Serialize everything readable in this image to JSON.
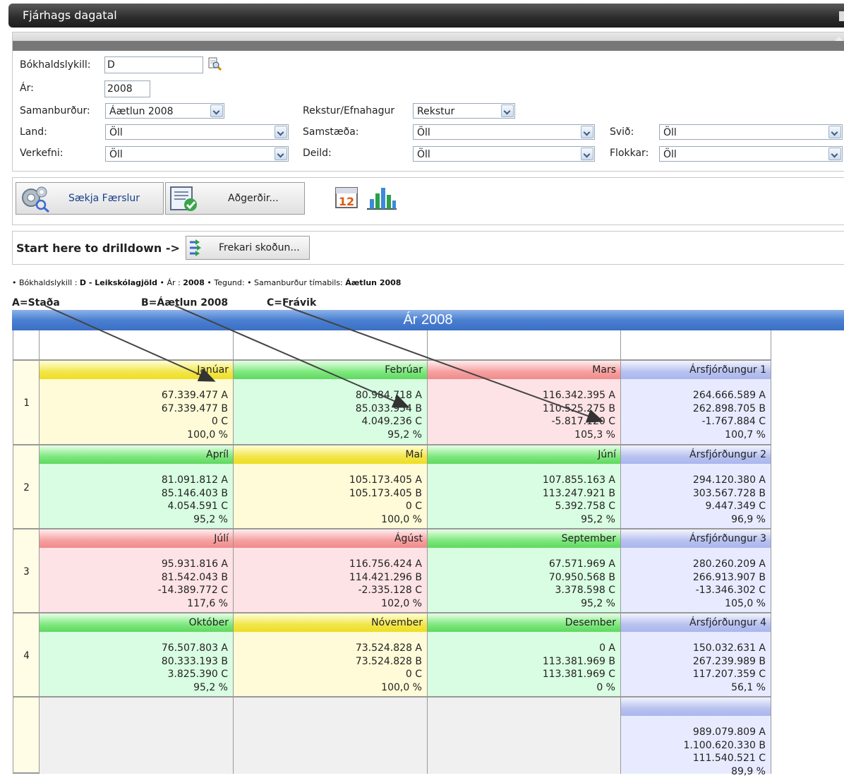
{
  "window": {
    "title": "Fjárhags dagatal"
  },
  "filters": {
    "key_label": "Bókhaldslykill:",
    "key_value": "D",
    "year_label": "Ár:",
    "year_value": "2008",
    "compare_label": "Samanburður:",
    "compare_value": "Áætlun 2008",
    "opexp_label": "Rekstur/Efnahagur",
    "opexp_value": "Rekstur",
    "land_label": "Land:",
    "land_value": "Öll",
    "group_label": "Samstæða:",
    "group_value": "Öll",
    "svid_label": "Svið:",
    "svid_value": "Öll",
    "project_label": "Verkefni:",
    "project_value": "Öll",
    "dept_label": "Deild:",
    "dept_value": "Öll",
    "flokkar_label": "Flokkar:",
    "flokkar_value": "Öll"
  },
  "toolbar": {
    "fetch_label": "Sækja Færslur",
    "actions_label": "Aðgerðir...",
    "calendar_icon_text": "12"
  },
  "drill": {
    "prompt": "Start here to drilldown ->",
    "button_label": "Frekari skoðun..."
  },
  "info": {
    "p1": "• Bókhaldslykill : ",
    "key": "D - Leikskólagjöld",
    "p2": " • Ár : ",
    "year": "2008",
    "p3": " • Tegund: • Samanburður tímabils: ",
    "compare": "Áætlun 2008"
  },
  "legend": {
    "a": "A=Staða",
    "b": "B=Áætlun 2008",
    "c": "C=Frávik"
  },
  "calendar": {
    "year_title": "Ár 2008",
    "rows": [
      {
        "num": "1",
        "cells": [
          {
            "name": "Janúar",
            "a": "67.339.477 A",
            "b": "67.339.477 B",
            "c": "0 C",
            "p": "100,0 %"
          },
          {
            "name": "Febrúar",
            "a": "80.984.718 A",
            "b": "85.033.954 B",
            "c": "4.049.236 C",
            "p": "95,2 %"
          },
          {
            "name": "Mars",
            "a": "116.342.395 A",
            "b": "110.525.275 B",
            "c": "-5.817.120 C",
            "p": "105,3 %"
          },
          {
            "name": "Ársfjórðungur 1",
            "a": "264.666.589 A",
            "b": "262.898.705 B",
            "c": "-1.767.884 C",
            "p": "100,7 %"
          }
        ]
      },
      {
        "num": "2",
        "cells": [
          {
            "name": "Apríl",
            "a": "81.091.812 A",
            "b": "85.146.403 B",
            "c": "4.054.591 C",
            "p": "95,2 %"
          },
          {
            "name": "Maí",
            "a": "105.173.405 A",
            "b": "105.173.405 B",
            "c": "0 C",
            "p": "100,0 %"
          },
          {
            "name": "Júní",
            "a": "107.855.163 A",
            "b": "113.247.921 B",
            "c": "5.392.758 C",
            "p": "95,2 %"
          },
          {
            "name": "Ársfjórðungur 2",
            "a": "294.120.380 A",
            "b": "303.567.728 B",
            "c": "9.447.349 C",
            "p": "96,9 %"
          }
        ]
      },
      {
        "num": "3",
        "cells": [
          {
            "name": "Júlí",
            "a": "95.931.816 A",
            "b": "81.542.043 B",
            "c": "-14.389.772 C",
            "p": "117,6 %"
          },
          {
            "name": "Ágúst",
            "a": "116.756.424 A",
            "b": "114.421.296 B",
            "c": "-2.335.128 C",
            "p": "102,0 %"
          },
          {
            "name": "September",
            "a": "67.571.969 A",
            "b": "70.950.568 B",
            "c": "3.378.598 C",
            "p": "95,2 %"
          },
          {
            "name": "Ársfjórðungur 3",
            "a": "280.260.209 A",
            "b": "266.913.907 B",
            "c": "-13.346.302 C",
            "p": "105,0 %"
          }
        ]
      },
      {
        "num": "4",
        "cells": [
          {
            "name": "Október",
            "a": "76.507.803 A",
            "b": "80.333.193 B",
            "c": "3.825.390 C",
            "p": "95,2 %"
          },
          {
            "name": "Nóvember",
            "a": "73.524.828 A",
            "b": "73.524.828 B",
            "c": "0 C",
            "p": "100,0 %"
          },
          {
            "name": "Desember",
            "a": "0 A",
            "b": "113.381.969 B",
            "c": "113.381.969 C",
            "p": "0 %"
          },
          {
            "name": "Ársfjórðungur 4",
            "a": "150.032.631 A",
            "b": "267.239.989 B",
            "c": "117.207.359 C",
            "p": "56,1 %"
          }
        ]
      }
    ],
    "total": {
      "a": "989.079.809 A",
      "b": "1.100.620.330 B",
      "c": "111.540.521 C",
      "p": "89,9 %"
    }
  },
  "colors": {
    "yellow": "#fffbd8",
    "green": "#d9fde2",
    "red": "#fde3e5",
    "quarter": "#e8ebff",
    "header_blue": "#3b6fc4"
  }
}
